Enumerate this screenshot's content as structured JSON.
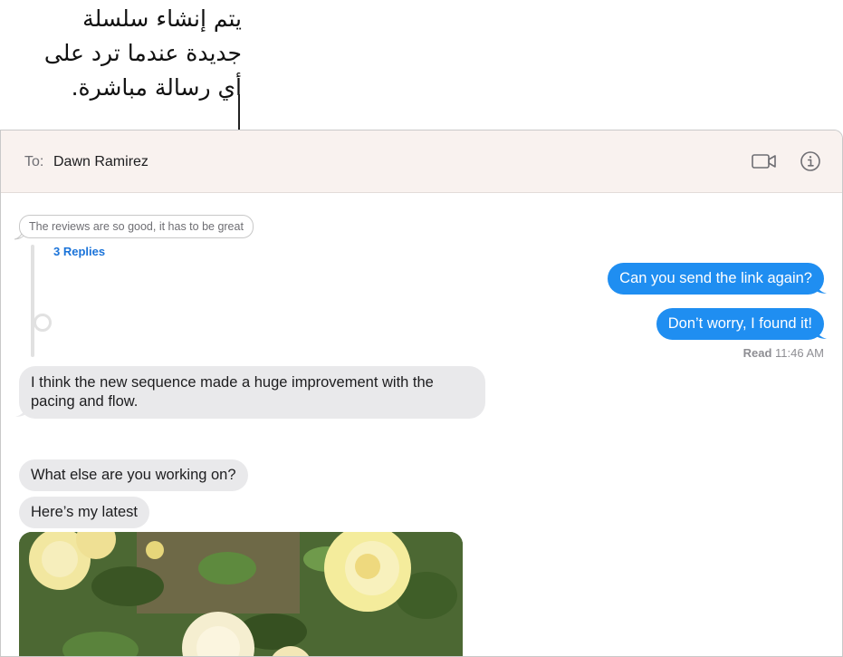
{
  "callout": {
    "lines": [
      "يتم إنشاء سلسلة",
      "جديدة عندما ترد على",
      "أي رسالة مباشرة."
    ]
  },
  "header": {
    "to_label": "To:",
    "recipient": "Dawn Ramirez",
    "icons": [
      "video-camera-icon",
      "info-icon"
    ]
  },
  "thread": {
    "quoted_message": "The reviews are so good, it has to be great",
    "replies_label": "3 Replies"
  },
  "messages": [
    {
      "from": "me",
      "text": "Can you send the link again?"
    },
    {
      "from": "me",
      "text": "Don’t worry, I found it!"
    },
    {
      "from": "them",
      "text": "I think the new sequence made a huge improvement with the pacing and flow."
    },
    {
      "from": "them",
      "text": "What else are you working on?"
    },
    {
      "from": "them",
      "text": "Here’s my latest"
    }
  ],
  "read_receipt": {
    "label": "Read",
    "time": "11:46 AM"
  },
  "attachment": {
    "type": "photo",
    "subject": "yellow-roses-photo"
  },
  "colors": {
    "sent_bubble": "#1f8ef1",
    "received_bubble": "#e9e9eb",
    "link": "#1a73d9",
    "header_bg": "#f9f2ef"
  }
}
